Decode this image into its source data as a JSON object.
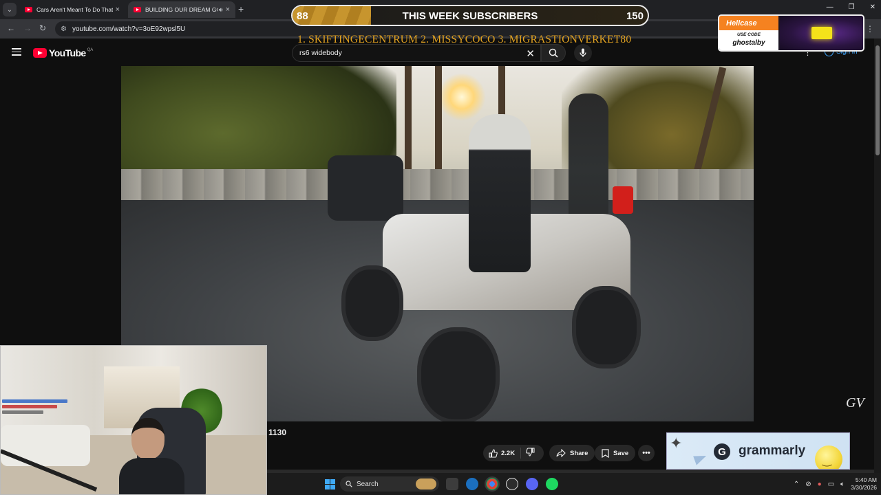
{
  "browser": {
    "tabs": [
      {
        "label": "Cars Aren't Meant To Do That -",
        "active": false
      },
      {
        "label": "BUILDING OUR DREAM GO",
        "active": true
      }
    ],
    "new_tab_icon": "plus-icon",
    "url": "youtube.com/watch?v=3oE92wpsl5U",
    "window_controls": [
      "minimize",
      "restore",
      "close"
    ]
  },
  "youtube": {
    "logo_text": "YouTube",
    "region": "QA",
    "search_value": "rs6 widebody",
    "signin_label": "Sign in"
  },
  "overlay": {
    "subscribers": {
      "min": "88",
      "title": "THIS WEEK SUBSCRIBERS",
      "max": "150",
      "progress": 0.22
    },
    "top_names": "1. SKIFTINGECENTRUM  2. MISSYCOCO  3. MIGRASTIONVERKET80",
    "sponsor": {
      "brand": "Hellcase",
      "use_code_label": "USE CODE",
      "code": "ghostalby"
    }
  },
  "video": {
    "count_label": "1130",
    "watermark": "GV"
  },
  "actions": {
    "likes": "2.2K",
    "share": "Share",
    "save": "Save",
    "more": "•••"
  },
  "ad": {
    "brand": "grammarly",
    "logo_letter": "G"
  },
  "taskbar": {
    "search_label": "Search",
    "time": "5:40 AM",
    "date": "3/30/2026"
  },
  "colors": {
    "yt_red": "#ff0033",
    "subscriber_gold": "#e3a321",
    "hellcase_orange": "#f58220",
    "link_blue": "#3ea6ff"
  }
}
